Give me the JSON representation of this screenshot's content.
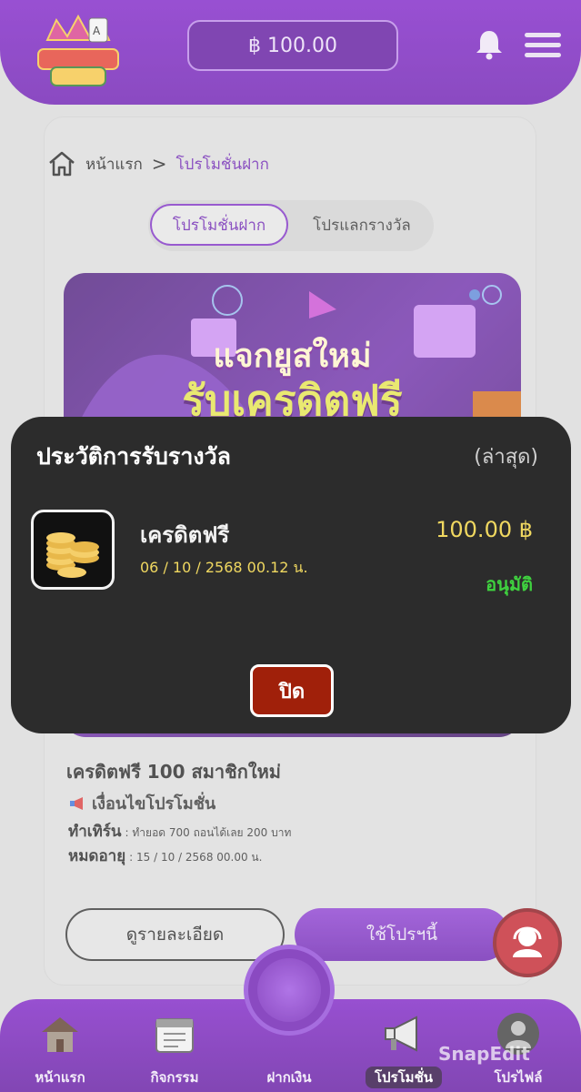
{
  "header": {
    "logo_alt": "MUNGHEE VIP",
    "balance": "฿ 100.00"
  },
  "breadcrumb": {
    "home": "หน้าแรก",
    "separator": ">",
    "current": "โปรโมชั่นฝาก"
  },
  "tabs": [
    {
      "label": "โปรโมชั่นฝาก",
      "active": true
    },
    {
      "label": "โปรแลกรางวัล",
      "active": false
    }
  ],
  "banner": {
    "line1": "แจกยูสใหม่",
    "line2": "รับเครดิตฟรี"
  },
  "promo": {
    "title": "เครดิตฟรี 100 สมาชิกใหม่",
    "condition_heading": "เงื่อนไขโปรโมชั่น",
    "turnover_label": "ทำเทิร์น",
    "turnover_value": ": ทำยอด 700 ถอนได้เลย 200 บาท",
    "expiry_label": "หมดอายุ",
    "expiry_value": ": 15 / 10 / 2568 00.00 น.",
    "details_button": "ดูรายละเอียด",
    "use_button": "ใช้โปรฯนี้"
  },
  "modal": {
    "title": "ประวัติการรับรางวัล",
    "subtitle": "(ล่าสุด)",
    "item": {
      "name": "เครดิตฟรี",
      "date": "06 / 10 / 2568 00.12 น.",
      "amount": "100.00 ฿",
      "status": "อนุมัติ"
    },
    "close_button": "ปิด"
  },
  "nav": [
    {
      "label": "หน้าแรก",
      "icon": "house-icon",
      "active": false
    },
    {
      "label": "กิจกรรม",
      "icon": "calendar-icon",
      "active": false
    },
    {
      "label": "ฝากเงิน",
      "icon": "coin-icon",
      "active": false
    },
    {
      "label": "โปรโมชั่น",
      "icon": "megaphone-icon",
      "active": true
    },
    {
      "label": "โปรไฟล์",
      "icon": "profile-icon",
      "active": false
    }
  ],
  "watermark": "SnapEdit",
  "colors": {
    "brand_purple": "#6a18b0",
    "modal_bg": "#2c2c2c",
    "amount_gold": "#f0d860",
    "status_green": "#3fd13f",
    "close_red": "#a0200a"
  }
}
